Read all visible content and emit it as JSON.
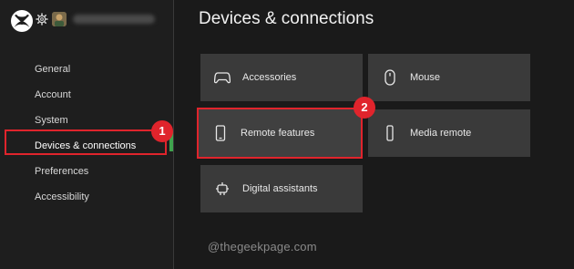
{
  "header": {
    "title": "Devices & connections"
  },
  "sidebar": {
    "items": [
      {
        "label": "General"
      },
      {
        "label": "Account"
      },
      {
        "label": "System"
      },
      {
        "label": "Devices & connections"
      },
      {
        "label": "Preferences"
      },
      {
        "label": "Accessibility"
      }
    ],
    "selected_index": 3
  },
  "tiles": [
    {
      "label": "Accessories",
      "icon": "controller-icon"
    },
    {
      "label": "Mouse",
      "icon": "mouse-icon"
    },
    {
      "label": "Remote features",
      "icon": "phone-icon"
    },
    {
      "label": "Media remote",
      "icon": "remote-icon"
    },
    {
      "label": "Digital assistants",
      "icon": "assistant-icon"
    }
  ],
  "annotations": [
    {
      "label": "1"
    },
    {
      "label": "2"
    }
  ],
  "watermark": "@thegeekpage.com",
  "colors": {
    "background": "#1a1a1a",
    "tile": "#3a3a3a",
    "highlight": "#e0242c",
    "accent": "#3fa34d"
  }
}
